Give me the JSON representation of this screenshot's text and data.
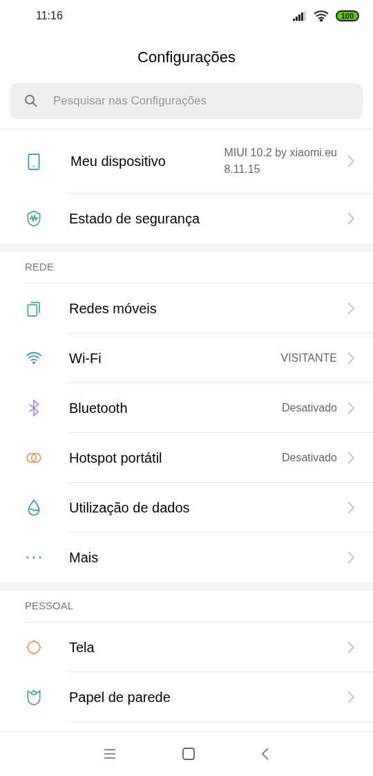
{
  "status_bar": {
    "time": "11:16",
    "battery": "100"
  },
  "title": "Configurações",
  "search": {
    "placeholder": "Pesquisar nas Configurações"
  },
  "sections": [
    {
      "items": [
        {
          "kind": "device",
          "label": "Meu dispositivo",
          "value": "MIUI 10.2 by xiaomi.eu\n8.11.15"
        },
        {
          "kind": "shield",
          "label": "Estado de segurança"
        }
      ]
    },
    {
      "header": "REDE",
      "items": [
        {
          "kind": "sim",
          "label": "Redes móveis"
        },
        {
          "kind": "wifi",
          "label": "Wi-Fi",
          "value": "VISITANTE"
        },
        {
          "kind": "bluetooth",
          "label": "Bluetooth",
          "value": "Desativado"
        },
        {
          "kind": "hotspot",
          "label": "Hotspot portátil",
          "value": "Desativado"
        },
        {
          "kind": "drop",
          "label": "Utilização de dados"
        },
        {
          "kind": "dots",
          "label": "Mais"
        }
      ]
    },
    {
      "header": "PESSOAL",
      "items": [
        {
          "kind": "sun",
          "label": "Tela"
        },
        {
          "kind": "tulip",
          "label": "Papel de parede"
        }
      ]
    }
  ]
}
